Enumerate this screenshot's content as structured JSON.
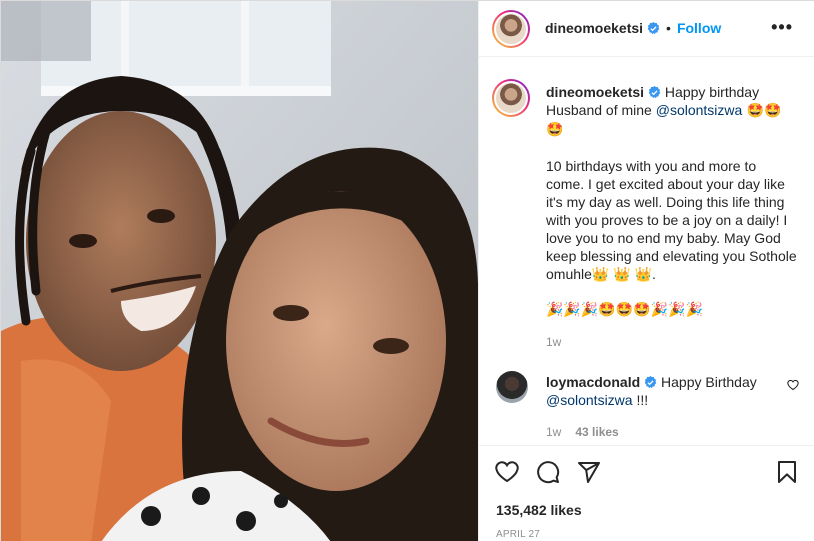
{
  "post": {
    "username": "dineomoeketsi",
    "follow_label": "Follow",
    "dot": "•",
    "more_label": "•••"
  },
  "caption": {
    "username": "dineomoeketsi",
    "line1_text": "Happy birthday Husband of mine ",
    "line1_mention": "@solontsizwa",
    "line1_emojis": " 🤩🤩 🤩",
    "paragraph2": "10 birthdays with you and more to come. I get excited about your day like it's my day as well. Doing this life thing with you proves to be a joy on a daily! I love you to no end my baby. May God keep blessing and elevating you Sothole omuhle👑 👑 👑.",
    "paragraph3": "🎉🎉🎉🤩🤩🤩🎉🎉🎉",
    "time": "1w"
  },
  "comment": {
    "username": "loymacdonald",
    "text": "Happy Birthday ",
    "mention": "@solontsizwa",
    "suffix": " !!!",
    "time": "1w",
    "likes": "43 likes"
  },
  "footer": {
    "likes": "135,482 likes",
    "date": "APRIL 27"
  },
  "icons": {
    "like": "heart-icon",
    "comment": "comment-icon",
    "share": "share-icon",
    "save": "bookmark-icon",
    "verified": "verified-badge-icon"
  },
  "colors": {
    "follow": "#0095f6",
    "verified": "#3897f0",
    "mention": "#00376b",
    "muted": "#8e8e8e"
  }
}
